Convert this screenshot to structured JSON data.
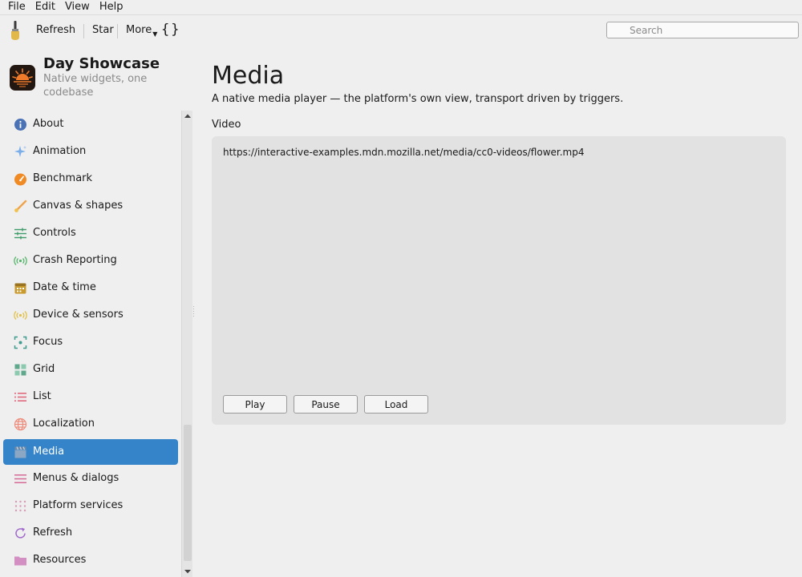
{
  "menu": [
    "File",
    "Edit",
    "View",
    "Help"
  ],
  "toolbar": {
    "refresh_label": "Refresh",
    "star_label": "Star",
    "more_label": "More",
    "braces_label": "{}",
    "search_placeholder": "Search"
  },
  "app": {
    "title": "Day Showcase",
    "subtitle": "Native widgets, one codebase"
  },
  "sidebar": {
    "selected": "Media",
    "items": [
      {
        "label": "About",
        "icon": "info-icon",
        "color": "#4a72b5"
      },
      {
        "label": "Animation",
        "icon": "sparkle-icon",
        "color": "#7aaee8"
      },
      {
        "label": "Benchmark",
        "icon": "gauge-icon",
        "color": "#f08a24"
      },
      {
        "label": "Canvas & shapes",
        "icon": "brush-icon",
        "color": "#f0a34a"
      },
      {
        "label": "Controls",
        "icon": "sliders-icon",
        "color": "#3f9c6b"
      },
      {
        "label": "Crash Reporting",
        "icon": "broadcast-icon",
        "color": "#56b56a"
      },
      {
        "label": "Date & time",
        "icon": "calendar-icon",
        "color": "#c99a2e"
      },
      {
        "label": "Device & sensors",
        "icon": "sensor-icon",
        "color": "#e2c14a"
      },
      {
        "label": "Focus",
        "icon": "focus-icon",
        "color": "#3f9c8e"
      },
      {
        "label": "Grid",
        "icon": "grid-icon",
        "color": "#5fa88b"
      },
      {
        "label": "List",
        "icon": "list-icon",
        "color": "#e06a7e"
      },
      {
        "label": "Localization",
        "icon": "globe-icon",
        "color": "#ee8a7a"
      },
      {
        "label": "Media",
        "icon": "clapperboard-icon",
        "color": "#8a8a8a"
      },
      {
        "label": "Menus & dialogs",
        "icon": "menu-icon",
        "color": "#d66a96"
      },
      {
        "label": "Platform services",
        "icon": "dots-grid-icon",
        "color": "#d89ab5"
      },
      {
        "label": "Refresh",
        "icon": "refresh-icon",
        "color": "#a06acb"
      },
      {
        "label": "Resources",
        "icon": "folder-icon",
        "color": "#d48fc2"
      }
    ]
  },
  "main": {
    "title": "Media",
    "description": "A native media player — the platform's own view, transport driven by triggers.",
    "section_label": "Video",
    "video_url": "https://interactive-examples.mdn.mozilla.net/media/cc0-videos/flower.mp4",
    "buttons": {
      "play": "Play",
      "pause": "Pause",
      "load": "Load"
    }
  },
  "colors": {
    "accent": "#3584c9",
    "panel": "#e2e2e2",
    "window": "#efefef"
  }
}
